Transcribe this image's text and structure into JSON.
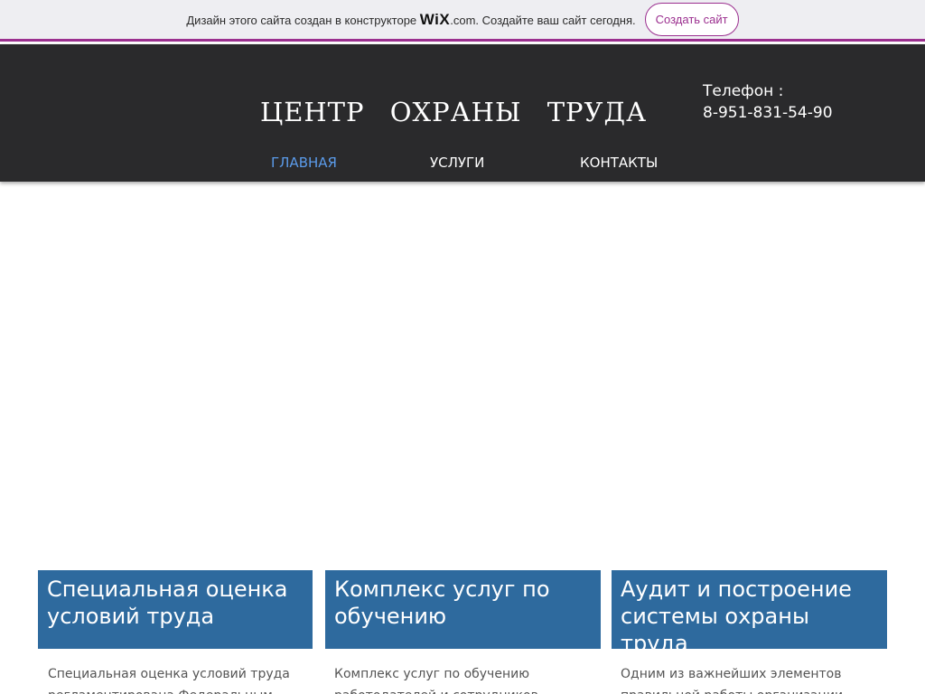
{
  "promo": {
    "text_before": "Дизайн этого сайта создан в конструкторе ",
    "wix_logo": "WiX",
    "domain": ".com",
    "text_after": ". Создайте ваш сайт сегодня.",
    "button_label": "Создать сайт"
  },
  "header": {
    "title": "ЦЕНТР ОХРАНЫ ТРУДА",
    "phone_label": "Телефон :",
    "phone_number": "8-951-831-54-90"
  },
  "nav": {
    "items": [
      {
        "label": "ГЛАВНАЯ",
        "active": true
      },
      {
        "label": "УСЛУГИ",
        "active": false
      },
      {
        "label": "КОНТАКТЫ",
        "active": false
      }
    ]
  },
  "cards": [
    {
      "title": "Специальная оценка условий труда",
      "text": "Специальная оценка условий труда регламентирована Федеральным законом"
    },
    {
      "title": "Комплекс услуг по обучению",
      "text": "Комплекс услуг по обучению работодателей и сотрудников, необходим всем"
    },
    {
      "title": "Аудит и построение системы охраны труда",
      "text": "Одним из важнейших элементов правильной работы организации, является"
    }
  ],
  "colors": {
    "promo_bg": "#eeeef2",
    "promo_accent": "#9b2f8f",
    "header_bg": "#2a2a2c",
    "nav_active": "#5b9bea",
    "card_bg": "#2e6a9e"
  }
}
